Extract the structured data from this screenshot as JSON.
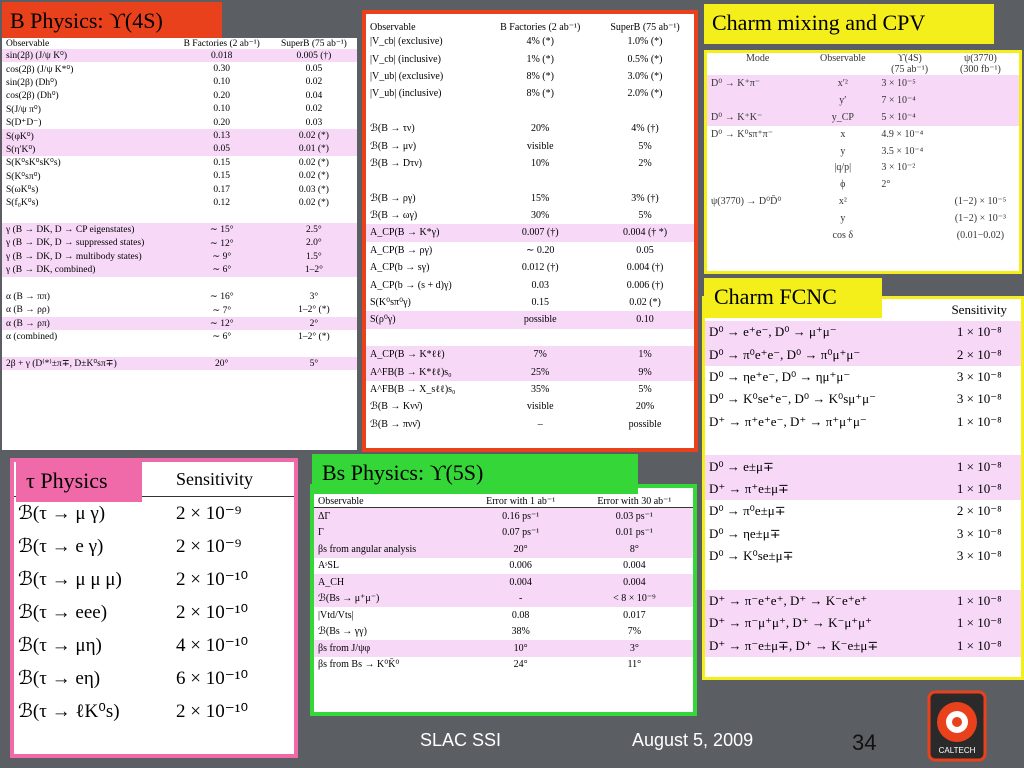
{
  "titles": {
    "b_physics": "B Physics:  ϒ(4S)",
    "charm_mixing": "Charm mixing and CPV",
    "charm_fcnc": "Charm FCNC",
    "tau_physics": "τ Physics",
    "bs_physics": "Bs Physics:  ϒ(5S)"
  },
  "b_physics": {
    "headers": [
      "Observable",
      "B Factories (2 ab⁻¹)",
      "SuperB (75 ab⁻¹)"
    ],
    "rows": [
      {
        "obs": "sin(2β) (J/ψ K⁰)",
        "bf": "0.018",
        "sb": "0.005 (†)",
        "hl": true
      },
      {
        "obs": "cos(2β) (J/ψ K*⁰)",
        "bf": "0.30",
        "sb": "0.05"
      },
      {
        "obs": "sin(2β) (Dh⁰)",
        "bf": "0.10",
        "sb": "0.02"
      },
      {
        "obs": "cos(2β) (Dh⁰)",
        "bf": "0.20",
        "sb": "0.04"
      },
      {
        "obs": "S(J/ψ π⁰)",
        "bf": "0.10",
        "sb": "0.02"
      },
      {
        "obs": "S(D⁺D⁻)",
        "bf": "0.20",
        "sb": "0.03"
      },
      {
        "obs": "S(φK⁰)",
        "bf": "0.13",
        "sb": "0.02 (*)",
        "hl": true
      },
      {
        "obs": "S(η′K⁰)",
        "bf": "0.05",
        "sb": "0.01 (*)",
        "hl": true
      },
      {
        "obs": "S(K⁰sK⁰sK⁰s)",
        "bf": "0.15",
        "sb": "0.02 (*)"
      },
      {
        "obs": "S(K⁰sπ⁰)",
        "bf": "0.15",
        "sb": "0.02 (*)"
      },
      {
        "obs": "S(ωK⁰s)",
        "bf": "0.17",
        "sb": "0.03 (*)"
      },
      {
        "obs": "S(f₀K⁰s)",
        "bf": "0.12",
        "sb": "0.02 (*)"
      },
      {
        "gap": true
      },
      {
        "obs": "γ (B → DK, D → CP eigenstates)",
        "bf": "∼ 15°",
        "sb": "2.5°",
        "hl": true
      },
      {
        "obs": "γ (B → DK, D → suppressed states)",
        "bf": "∼ 12°",
        "sb": "2.0°",
        "hl": true
      },
      {
        "obs": "γ (B → DK, D → multibody states)",
        "bf": "∼ 9°",
        "sb": "1.5°",
        "hl": true
      },
      {
        "obs": "γ (B → DK, combined)",
        "bf": "∼ 6°",
        "sb": "1–2°",
        "hl": true
      },
      {
        "gap": true
      },
      {
        "obs": "α (B → ππ)",
        "bf": "∼ 16°",
        "sb": "3°"
      },
      {
        "obs": "α (B → ρρ)",
        "bf": "∼ 7°",
        "sb": "1–2° (*)"
      },
      {
        "obs": "α (B → ρπ)",
        "bf": "∼ 12°",
        "sb": "2°",
        "hl": true
      },
      {
        "obs": "α (combined)",
        "bf": "∼ 6°",
        "sb": "1–2° (*)"
      },
      {
        "gap": true
      },
      {
        "obs": "2β + γ (D⁽*⁾±π∓, D±K⁰sπ∓)",
        "bf": "20°",
        "sb": "5°",
        "hl": true
      }
    ]
  },
  "middle": {
    "headers": [
      "Observable",
      "B Factories (2 ab⁻¹)",
      "SuperB (75 ab⁻¹)"
    ],
    "rows": [
      {
        "obs": "|V_cb| (exclusive)",
        "bf": "4% (*)",
        "sb": "1.0% (*)"
      },
      {
        "obs": "|V_cb| (inclusive)",
        "bf": "1% (*)",
        "sb": "0.5% (*)"
      },
      {
        "obs": "|V_ub| (exclusive)",
        "bf": "8% (*)",
        "sb": "3.0% (*)"
      },
      {
        "obs": "|V_ub| (inclusive)",
        "bf": "8% (*)",
        "sb": "2.0% (*)"
      },
      {
        "gap": true
      },
      {
        "obs": "ℬ(B → τν)",
        "bf": "20%",
        "sb": "4% (†)"
      },
      {
        "obs": "ℬ(B → μν)",
        "bf": "visible",
        "sb": "5%"
      },
      {
        "obs": "ℬ(B → Dτν)",
        "bf": "10%",
        "sb": "2%"
      },
      {
        "gap": true
      },
      {
        "obs": "ℬ(B → ργ)",
        "bf": "15%",
        "sb": "3% (†)"
      },
      {
        "obs": "ℬ(B → ωγ)",
        "bf": "30%",
        "sb": "5%"
      },
      {
        "obs": "A_CP(B → K*γ)",
        "bf": "0.007 (†)",
        "sb": "0.004 († *)",
        "hl": true
      },
      {
        "obs": "A_CP(B → ργ)",
        "bf": "∼ 0.20",
        "sb": "0.05"
      },
      {
        "obs": "A_CP(b → sγ)",
        "bf": "0.012 (†)",
        "sb": "0.004 (†)"
      },
      {
        "obs": "A_CP(b → (s + d)γ)",
        "bf": "0.03",
        "sb": "0.006 (†)"
      },
      {
        "obs": "S(K⁰sπ⁰γ)",
        "bf": "0.15",
        "sb": "0.02 (*)"
      },
      {
        "obs": "S(ρ⁰γ)",
        "bf": "possible",
        "sb": "0.10",
        "hl": true
      },
      {
        "gap": true
      },
      {
        "obs": "A_CP(B → K*ℓℓ)",
        "bf": "7%",
        "sb": "1%",
        "hl": true
      },
      {
        "obs": "A^FB(B → K*ℓℓ)s₀",
        "bf": "25%",
        "sb": "9%",
        "hl": true
      },
      {
        "obs": "A^FB(B → X_sℓℓ)s₀",
        "bf": "35%",
        "sb": "5%"
      },
      {
        "obs": "ℬ(B → Kνν̄)",
        "bf": "visible",
        "sb": "20%"
      },
      {
        "obs": "ℬ(B → πνν̄)",
        "bf": "–",
        "sb": "possible"
      }
    ]
  },
  "charm_mixing": {
    "headers": [
      "Mode",
      "Observable",
      "ϒ(4S)",
      "ψ(3770)"
    ],
    "subheaders": [
      "",
      "",
      "(75 ab⁻¹)",
      "(300 fb⁻¹)"
    ],
    "rows": [
      {
        "mode": "D⁰ → K⁺π⁻",
        "obs": "x′²",
        "u4s": "3 × 10⁻⁵",
        "psi": "",
        "hl": true
      },
      {
        "mode": "",
        "obs": "y′",
        "u4s": "7 × 10⁻⁴",
        "psi": "",
        "hl": true
      },
      {
        "mode": "D⁰ → K⁺K⁻",
        "obs": "y_CP",
        "u4s": "5 × 10⁻⁴",
        "psi": "",
        "hl": true
      },
      {
        "mode": "D⁰ → K⁰sπ⁺π⁻",
        "obs": "x",
        "u4s": "4.9 × 10⁻⁴",
        "psi": ""
      },
      {
        "mode": "",
        "obs": "y",
        "u4s": "3.5 × 10⁻⁴",
        "psi": ""
      },
      {
        "mode": "",
        "obs": "|q/p|",
        "u4s": "3 × 10⁻²",
        "psi": ""
      },
      {
        "mode": "",
        "obs": "ϕ",
        "u4s": "2°",
        "psi": ""
      },
      {
        "mode": "ψ(3770) → D⁰D̄⁰",
        "obs": "x²",
        "u4s": "",
        "psi": "(1−2) × 10⁻⁵"
      },
      {
        "mode": "",
        "obs": "y",
        "u4s": "",
        "psi": "(1−2) × 10⁻³"
      },
      {
        "mode": "",
        "obs": "cos δ",
        "u4s": "",
        "psi": "(0.01−0.02)"
      }
    ]
  },
  "charm_fcnc": {
    "header": "Sensitivity",
    "rows": [
      {
        "mode": "D⁰ → e⁺e⁻, D⁰ → μ⁺μ⁻",
        "sens": "1 × 10⁻⁸",
        "hl": true
      },
      {
        "mode": "D⁰ → π⁰e⁺e⁻, D⁰ → π⁰μ⁺μ⁻",
        "sens": "2 × 10⁻⁸",
        "hl": true
      },
      {
        "mode": "D⁰ → ηe⁺e⁻, D⁰ → ημ⁺μ⁻",
        "sens": "3 × 10⁻⁸"
      },
      {
        "mode": "D⁰ → K⁰se⁺e⁻, D⁰ → K⁰sμ⁺μ⁻",
        "sens": "3 × 10⁻⁸"
      },
      {
        "mode": "D⁺ → π⁺e⁺e⁻, D⁺ → π⁺μ⁺μ⁻",
        "sens": "1 × 10⁻⁸"
      },
      {
        "gap": true
      },
      {
        "mode": "D⁰ → e±μ∓",
        "sens": "1 × 10⁻⁸",
        "hl": true
      },
      {
        "mode": "D⁺ → π⁺e±μ∓",
        "sens": "1 × 10⁻⁸",
        "hl": true
      },
      {
        "mode": "D⁰ → π⁰e±μ∓",
        "sens": "2 × 10⁻⁸"
      },
      {
        "mode": "D⁰ → ηe±μ∓",
        "sens": "3 × 10⁻⁸"
      },
      {
        "mode": "D⁰ → K⁰se±μ∓",
        "sens": "3 × 10⁻⁸"
      },
      {
        "gap": true
      },
      {
        "mode": "D⁺ → π⁻e⁺e⁺, D⁺ → K⁻e⁺e⁺",
        "sens": "1 × 10⁻⁸",
        "hl": true
      },
      {
        "mode": "D⁺ → π⁻μ⁺μ⁺, D⁺ → K⁻μ⁺μ⁺",
        "sens": "1 × 10⁻⁸",
        "hl": true
      },
      {
        "mode": "D⁺ → π⁻e±μ∓, D⁺ → K⁻e±μ∓",
        "sens": "1 × 10⁻⁸",
        "hl": true
      }
    ]
  },
  "tau": {
    "header": "Sensitivity",
    "rows": [
      {
        "mode": "ℬ(τ → μ γ)",
        "sens": "2 × 10⁻⁹"
      },
      {
        "mode": "ℬ(τ → e γ)",
        "sens": "2 × 10⁻⁹"
      },
      {
        "mode": "ℬ(τ → μ μ μ)",
        "sens": "2 × 10⁻¹⁰"
      },
      {
        "mode": "ℬ(τ → eee)",
        "sens": "2 × 10⁻¹⁰"
      },
      {
        "mode": "ℬ(τ → μη)",
        "sens": "4 × 10⁻¹⁰"
      },
      {
        "mode": "ℬ(τ → eη)",
        "sens": "6 × 10⁻¹⁰"
      },
      {
        "mode": "ℬ(τ → ℓK⁰s)",
        "sens": "2 × 10⁻¹⁰"
      }
    ]
  },
  "bs": {
    "headers": [
      "Observable",
      "Error with 1 ab⁻¹",
      "Error with 30 ab⁻¹"
    ],
    "rows": [
      {
        "obs": "ΔΓ",
        "e1": "0.16 ps⁻¹",
        "e30": "0.03 ps⁻¹",
        "hl": true
      },
      {
        "obs": "Γ",
        "e1": "0.07 ps⁻¹",
        "e30": "0.01 ps⁻¹",
        "hl": true
      },
      {
        "obs": "βs from angular analysis",
        "e1": "20°",
        "e30": "8°",
        "hl": true
      },
      {
        "obs": "AˢSL",
        "e1": "0.006",
        "e30": "0.004"
      },
      {
        "obs": "A_CH",
        "e1": "0.004",
        "e30": "0.004",
        "hl": true
      },
      {
        "obs": "ℬ(Bs → μ⁺μ⁻)",
        "e1": "-",
        "e30": "< 8 × 10⁻⁹",
        "hl": true
      },
      {
        "obs": "|Vtd/Vts|",
        "e1": "0.08",
        "e30": "0.017"
      },
      {
        "obs": "ℬ(Bs → γγ)",
        "e1": "38%",
        "e30": "7%"
      },
      {
        "obs": "βs from J/ψφ",
        "e1": "10°",
        "e30": "3°",
        "hl": true
      },
      {
        "obs": "βs from Bs → K⁰K̄⁰",
        "e1": "24°",
        "e30": "11°"
      }
    ]
  },
  "footer": {
    "venue": "SLAC SSI",
    "date": "August 5, 2009",
    "page": "34",
    "logo_text": "CALTECH"
  },
  "colors": {
    "highlight": "#f7d9f7",
    "b_title_bg": "#e8411c",
    "charm_title_bg": "#f4ef1a",
    "tau_title_bg": "#f06aa9",
    "bs_title_bg": "#35d637",
    "background": "#5b5f63"
  }
}
